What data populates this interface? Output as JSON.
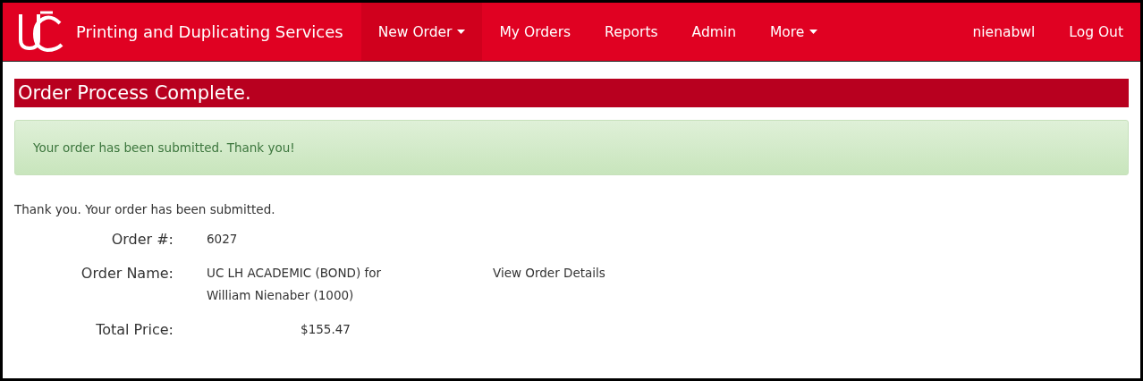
{
  "brand": {
    "title": "Printing and Duplicating Services"
  },
  "nav": [
    {
      "label": "New Order",
      "selected": true,
      "dropdown": true
    },
    {
      "label": "My Orders",
      "selected": false,
      "dropdown": false
    },
    {
      "label": "Reports",
      "selected": false,
      "dropdown": false
    },
    {
      "label": "Admin",
      "selected": false,
      "dropdown": false
    },
    {
      "label": "More",
      "selected": false,
      "dropdown": true
    }
  ],
  "user_nav": [
    "nienabwl",
    "Log Out"
  ],
  "heading": "Order Process Complete.",
  "alert": "Your order has been submitted. Thank you!",
  "message": "Thank you. Your order has been submitted.",
  "details": [
    {
      "kind": "text",
      "label": "Order #:",
      "value": [
        "6027"
      ]
    },
    {
      "kind": "text",
      "label": "Order Name:",
      "value": [
        "UC LH ACADEMIC (BOND) for",
        "William Nienaber (1000)"
      ],
      "link": "View Order Details"
    },
    {
      "kind": "amount",
      "label": "Total Price:",
      "value": [
        "$155.47"
      ]
    }
  ]
}
